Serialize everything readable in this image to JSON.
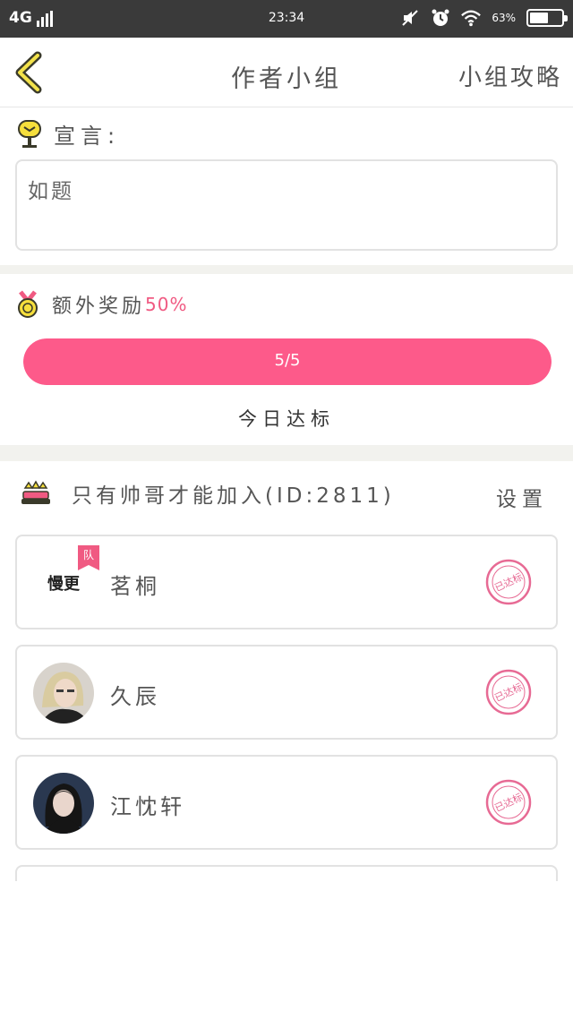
{
  "status_bar": {
    "network": "4G",
    "time": "23:34",
    "battery": "63%",
    "battery_level": 0.63
  },
  "nav": {
    "title": "作者小组",
    "right_action": "小组攻略"
  },
  "manifesto": {
    "label": "宣言:",
    "text": "如题"
  },
  "bonus": {
    "label": "额外奖励",
    "percent": "50%",
    "progress_text": "5/5",
    "progress_fraction": 1.0,
    "status": "今日达标"
  },
  "team": {
    "name": "只有帅哥才能加入(ID:2811)",
    "settings_label": "设置",
    "members": [
      {
        "name": "茗桐",
        "avatar_text": "慢更",
        "tag": "队",
        "stamp": "已达标"
      },
      {
        "name": "久辰",
        "stamp": "已达标"
      },
      {
        "name": "江忱轩",
        "stamp": "已达标"
      }
    ]
  },
  "colors": {
    "accent": "#fd5a8a",
    "accent_light": "#fde0e8",
    "text": "#555555",
    "divider": "#f2f2ee",
    "stamp": "#e76a94"
  }
}
